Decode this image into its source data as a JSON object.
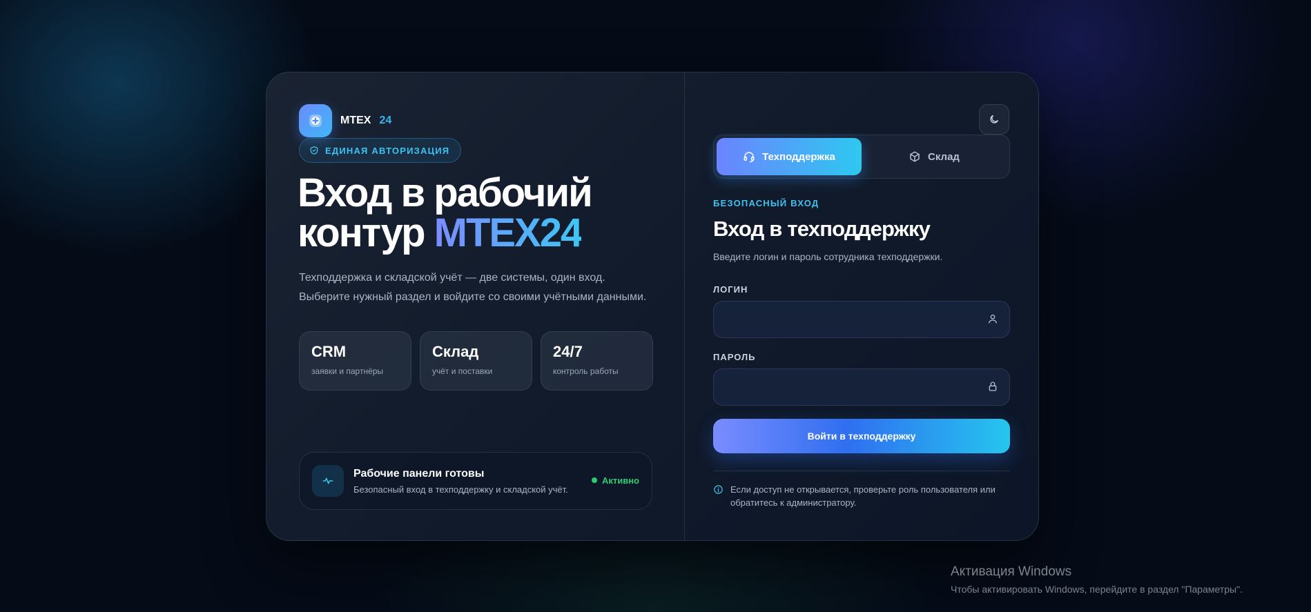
{
  "brand": {
    "name": "MTEX",
    "number": "24"
  },
  "badge": {
    "label": "ЕДИНАЯ АВТОРИЗАЦИЯ"
  },
  "hero": {
    "line1": "Вход в рабочий",
    "line2": "контур",
    "accent": "MTEX24"
  },
  "description": {
    "line1": "Техподдержка и складской учёт — две системы, один вход.",
    "line2": "Выберите нужный раздел и войдите со своими учётными данными."
  },
  "stats": [
    {
      "title": "CRM",
      "subtitle": "заявки и партнёры"
    },
    {
      "title": "Склад",
      "subtitle": "учёт и поставки"
    },
    {
      "title": "24/7",
      "subtitle": "контроль работы"
    }
  ],
  "status": {
    "title": "Рабочие панели готовы",
    "subtitle": "Безопасный вход в техподдержку и складской учёт.",
    "badge": "Активно"
  },
  "tabs": [
    {
      "label": "Техподдержка",
      "active": true,
      "icon": "headset-icon"
    },
    {
      "label": "Склад",
      "active": false,
      "icon": "box-icon"
    }
  ],
  "form": {
    "eyebrow": "БЕЗОПАСНЫЙ ВХОД",
    "title": "Вход в техподдержку",
    "subtitle": "Введите логин и пароль сотрудника техподдержки.",
    "login_label": "ЛОГИН",
    "login_value": "",
    "password_label": "ПАРОЛЬ",
    "password_value": "",
    "submit_label": "Войти в техподдержку",
    "note": "Если доступ не открывается, проверьте роль пользователя или обратитесь к администратору."
  },
  "watermark": {
    "title": "Активация Windows",
    "subtitle": "Чтобы активировать Windows, перейдите в раздел \"Параметры\"."
  },
  "colors": {
    "accent_cyan": "#3fc2ef",
    "accent_blue": "#6b84ff",
    "status_green": "#2ecc71",
    "background": "#050b17"
  }
}
